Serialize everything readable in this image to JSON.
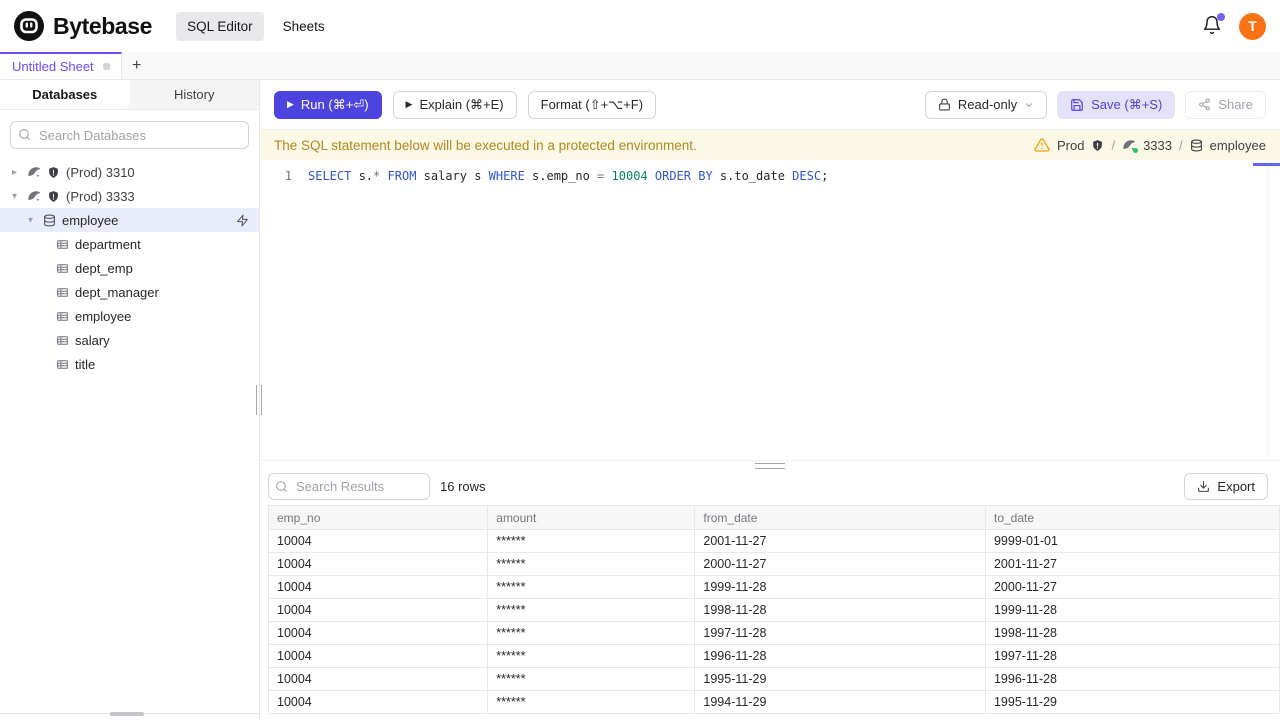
{
  "colors": {
    "accent": "#4d43df",
    "tab_accent": "#6d4aff",
    "avatar_bg": "#f97316",
    "banner_bg": "#fcf8e6",
    "banner_text": "#b5861c",
    "selected_row_bg": "#e9ecfb",
    "notification_dot": "#7c5cff",
    "status_green": "#22c55e"
  },
  "topbar": {
    "brand": "Bytebase",
    "nav_sql_editor": "SQL Editor",
    "nav_sheets": "Sheets",
    "avatar_initial": "T"
  },
  "sheet_tabs": {
    "active_label": "Untitled Sheet",
    "add_label": "+"
  },
  "sidebar": {
    "tab_databases": "Databases",
    "tab_history": "History",
    "search_placeholder": "Search Databases",
    "caret_collapsed": "▸",
    "caret_expanded": "▾",
    "instances": [
      {
        "label": "(Prod) 3310"
      },
      {
        "label": "(Prod) 3333"
      }
    ],
    "database": "employee",
    "tables": [
      "department",
      "dept_emp",
      "dept_manager",
      "employee",
      "salary",
      "title"
    ]
  },
  "toolbar": {
    "run_label": "Run (⌘+⏎)",
    "explain_label": "Explain (⌘+E)",
    "format_label": "Format (⇧+⌥+F)",
    "readonly_label": "Read-only",
    "save_label": "Save (⌘+S)",
    "share_label": "Share"
  },
  "banner": {
    "message": "The SQL statement below will be executed in a protected environment.",
    "environment": "Prod",
    "separator": "/",
    "instance": "3333",
    "database": "employee"
  },
  "editor": {
    "line_number": "1",
    "sql": "SELECT s.* FROM salary s WHERE s.emp_no = 10004 ORDER BY s.to_date DESC;",
    "tokens": [
      {
        "text": "SELECT",
        "type": "keyword"
      },
      {
        "text": " s.",
        "type": "ident"
      },
      {
        "text": "*",
        "type": "operator"
      },
      {
        "text": " ",
        "type": "ident"
      },
      {
        "text": "FROM",
        "type": "keyword"
      },
      {
        "text": " salary s ",
        "type": "ident"
      },
      {
        "text": "WHERE",
        "type": "keyword"
      },
      {
        "text": " s.emp_no ",
        "type": "ident"
      },
      {
        "text": "=",
        "type": "operator"
      },
      {
        "text": " ",
        "type": "ident"
      },
      {
        "text": "10004",
        "type": "number"
      },
      {
        "text": " ",
        "type": "ident"
      },
      {
        "text": "ORDER",
        "type": "keyword"
      },
      {
        "text": " ",
        "type": "ident"
      },
      {
        "text": "BY",
        "type": "keyword"
      },
      {
        "text": " s.to_date ",
        "type": "ident"
      },
      {
        "text": "DESC",
        "type": "keyword"
      },
      {
        "text": ";",
        "type": "ident"
      }
    ]
  },
  "results": {
    "search_placeholder": "Search Results",
    "row_count": "16 rows",
    "export_label": "Export",
    "columns": [
      "emp_no",
      "amount",
      "from_date",
      "to_date"
    ],
    "rows": [
      [
        "10004",
        "******",
        "2001-11-27",
        "9999-01-01"
      ],
      [
        "10004",
        "******",
        "2000-11-27",
        "2001-11-27"
      ],
      [
        "10004",
        "******",
        "1999-11-28",
        "2000-11-27"
      ],
      [
        "10004",
        "******",
        "1998-11-28",
        "1999-11-28"
      ],
      [
        "10004",
        "******",
        "1997-11-28",
        "1998-11-28"
      ],
      [
        "10004",
        "******",
        "1996-11-28",
        "1997-11-28"
      ],
      [
        "10004",
        "******",
        "1995-11-29",
        "1996-11-28"
      ],
      [
        "10004",
        "******",
        "1994-11-29",
        "1995-11-29"
      ]
    ]
  }
}
